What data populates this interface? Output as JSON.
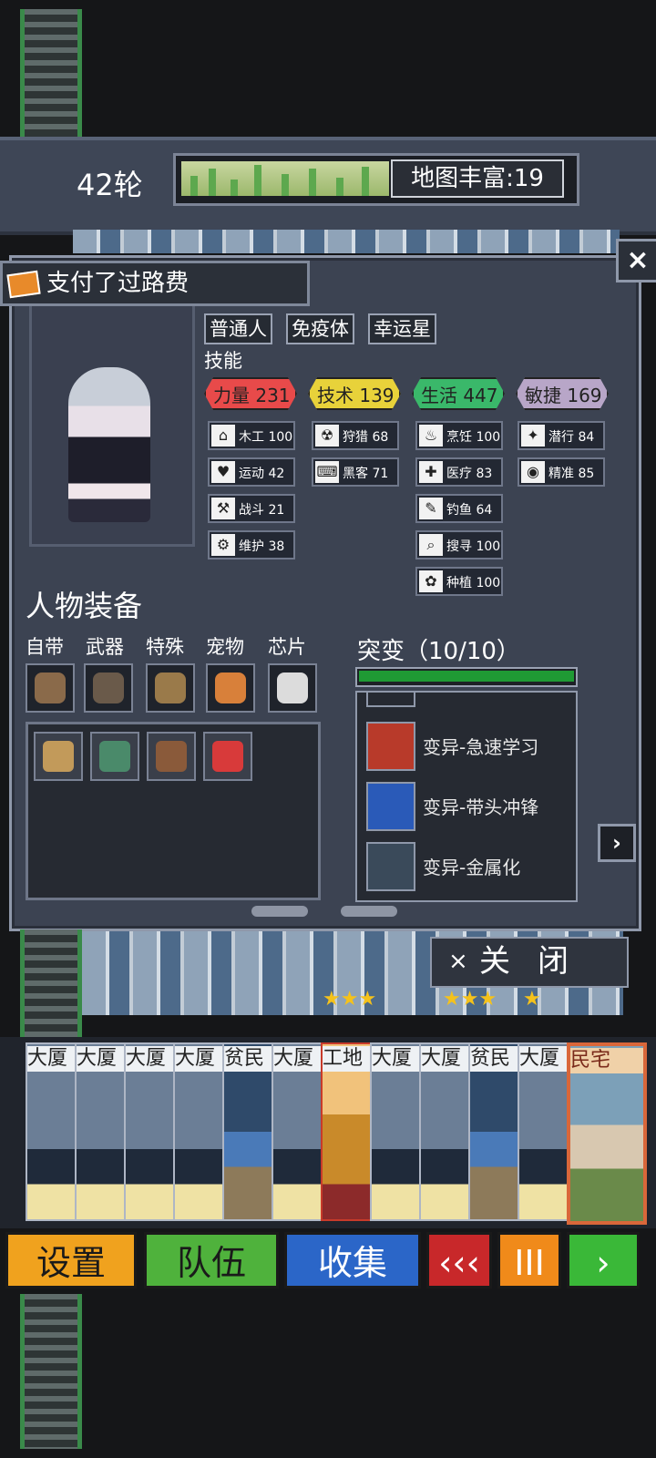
{
  "header": {
    "turn": "42轮",
    "map_richness": "地图丰富:19"
  },
  "toast": {
    "text": "支付了过路费"
  },
  "close_x": "×",
  "character": {
    "tags": [
      "普通人",
      "免疫体",
      "幸运星"
    ],
    "skills_label": "技能",
    "stats": [
      {
        "label": "力量 231",
        "color": "#e84a4a"
      },
      {
        "label": "技术 139",
        "color": "#e8d23a"
      },
      {
        "label": "生活 447",
        "color": "#3ab86a"
      },
      {
        "label": "敏捷 169",
        "color": "#b8a6c8"
      }
    ],
    "skills": [
      {
        "icon": "house-icon",
        "glyph": "⌂",
        "label": "木工 100",
        "col": 0,
        "row": 0
      },
      {
        "icon": "heart-icon",
        "glyph": "♥",
        "label": "运动 42",
        "col": 0,
        "row": 1
      },
      {
        "icon": "hammer-icon",
        "glyph": "⚒",
        "label": "战斗 21",
        "col": 0,
        "row": 2
      },
      {
        "icon": "wrench-icon",
        "glyph": "⚙",
        "label": "维护 38",
        "col": 0,
        "row": 3
      },
      {
        "icon": "radiation-icon",
        "glyph": "☢",
        "label": "狩猎 68",
        "col": 1,
        "row": 0
      },
      {
        "icon": "hacker-icon",
        "glyph": "⌨",
        "label": "黑客 71",
        "col": 1,
        "row": 1
      },
      {
        "icon": "cooking-icon",
        "glyph": "♨",
        "label": "烹饪 100",
        "col": 2,
        "row": 0
      },
      {
        "icon": "medkit-icon",
        "glyph": "✚",
        "label": "医疗 83",
        "col": 2,
        "row": 1
      },
      {
        "icon": "fishing-icon",
        "glyph": "✎",
        "label": "钓鱼 64",
        "col": 2,
        "row": 2
      },
      {
        "icon": "search-icon",
        "glyph": "⌕",
        "label": "搜寻 100",
        "col": 2,
        "row": 3
      },
      {
        "icon": "planting-icon",
        "glyph": "✿",
        "label": "种植 100",
        "col": 2,
        "row": 4
      },
      {
        "icon": "sneak-icon",
        "glyph": "✦",
        "label": "潜行 84",
        "col": 3,
        "row": 0
      },
      {
        "icon": "eye-icon",
        "glyph": "◉",
        "label": "精准 85",
        "col": 3,
        "row": 1
      }
    ]
  },
  "equipment": {
    "title": "人物装备",
    "slot_labels": [
      "自带",
      "武器",
      "特殊",
      "宠物",
      "芯片"
    ],
    "slots": [
      {
        "name": "bow-icon",
        "color": "#8a6a4a"
      },
      {
        "name": "rifle-icon",
        "color": "#6a5a4a"
      },
      {
        "name": "pinecone-icon",
        "color": "#9a7a4a"
      },
      {
        "name": "crab-icon",
        "color": "#d8803a"
      },
      {
        "name": "chip-icon",
        "color": "#dcdcdc"
      }
    ],
    "inventory": [
      {
        "name": "wooden-stick-icon",
        "color": "#c29a5a"
      },
      {
        "name": "green-backpack-icon",
        "color": "#4a8a6a"
      },
      {
        "name": "brown-backpack-icon",
        "color": "#8a5a3a"
      },
      {
        "name": "medkit-bag-icon",
        "color": "#d83a3a"
      }
    ]
  },
  "mutation": {
    "title": "突变（10/10）",
    "progress": 1.0,
    "items": [
      {
        "name": "变异-急速学习",
        "icon": "burst-icon",
        "color": "#b83a2a"
      },
      {
        "name": "变异-带头冲锋",
        "icon": "angel-icon",
        "color": "#2a5ab8"
      },
      {
        "name": "变异-金属化",
        "icon": "metal-icon",
        "color": "#3a4a5a"
      }
    ]
  },
  "close_button": {
    "icon": "×",
    "label": "关闭"
  },
  "cards": [
    {
      "label": "大厦",
      "kind": "tower"
    },
    {
      "label": "大厦",
      "kind": "tower"
    },
    {
      "label": "大厦",
      "kind": "tower"
    },
    {
      "label": "大厦",
      "kind": "tower"
    },
    {
      "label": "贫民",
      "kind": "poor"
    },
    {
      "label": "大厦",
      "kind": "tower"
    },
    {
      "label": "工地",
      "kind": "site"
    },
    {
      "label": "大厦",
      "kind": "tower"
    },
    {
      "label": "大厦",
      "kind": "tower"
    },
    {
      "label": "贫民",
      "kind": "poor"
    },
    {
      "label": "大厦",
      "kind": "tower"
    },
    {
      "label": "民宅",
      "kind": "house"
    }
  ],
  "bottom_buttons": [
    {
      "label": "设置",
      "color": "#f0a21e",
      "name": "settings-button"
    },
    {
      "label": "队伍",
      "color": "#4fb23c",
      "name": "team-button"
    },
    {
      "label": "收集",
      "color": "#2b66c8",
      "name": "collection-button"
    },
    {
      "label": "‹‹‹",
      "color": "#c8282a",
      "name": "rewind-button"
    },
    {
      "label": "III",
      "color": "#f08a1a",
      "name": "pause-button"
    },
    {
      "label": "›",
      "color": "#3ab838",
      "name": "play-button"
    }
  ]
}
